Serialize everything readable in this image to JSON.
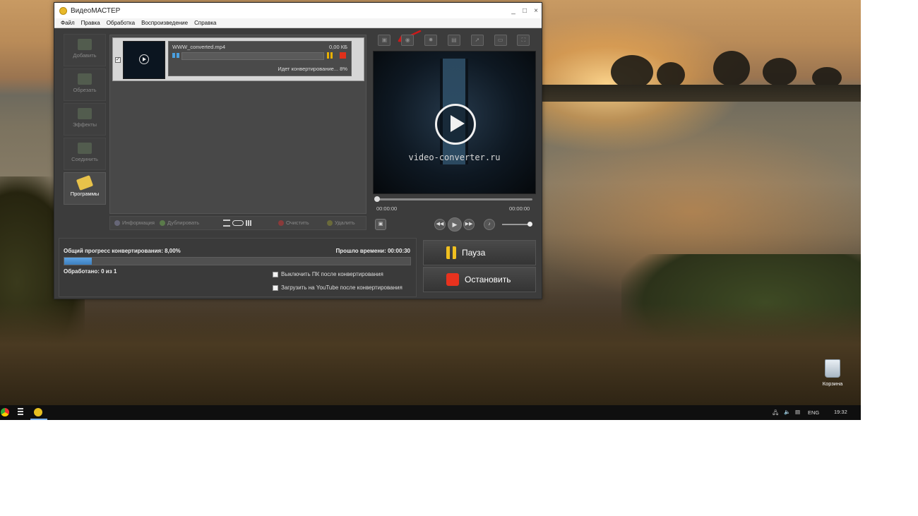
{
  "window": {
    "title": "ВидеоМАСТЕР",
    "controls": [
      "_",
      "□",
      "×"
    ]
  },
  "menu": [
    "Файл",
    "Правка",
    "Обработка",
    "Воспроизведение",
    "Справка"
  ],
  "sidebar": [
    {
      "label": "Добавить",
      "icon": "add-video-icon"
    },
    {
      "label": "Обрезать",
      "icon": "trim-icon"
    },
    {
      "label": "Эффекты",
      "icon": "effects-icon"
    },
    {
      "label": "Соединить",
      "icon": "join-icon"
    },
    {
      "label": "Программы",
      "icon": "programs-icon"
    }
  ],
  "file_item": {
    "name": "WWW_converted.mp4",
    "size": "0,00 КБ",
    "status": "Идет конвертирование... 8%",
    "progress": 0.0
  },
  "file_tools": {
    "info": "Информация",
    "duplicate": "Дублировать",
    "clear": "Очистить",
    "delete": "Удалить"
  },
  "preview": {
    "watermark": "video-converter.ru",
    "time_current": "00:00:00",
    "time_total": "00:00:00",
    "tools": [
      "crop-icon",
      "snapshot-icon",
      "brightness-icon",
      "film-icon",
      "speed-icon",
      "gif-icon",
      "fullscreen-icon"
    ]
  },
  "progress": {
    "total_label": "Общий прогресс конвертирования: 8,00%",
    "elapsed_label": "Прошло времени: 00:00:30",
    "processed_label": "Обработано: 0 из 1",
    "total_fraction": 0.08,
    "shutdown_option": "Выключить ПК после конвертирования",
    "youtube_option": "Загрузить на YouTube после конвертирования"
  },
  "actions": {
    "pause": "Пауза",
    "stop": "Остановить"
  },
  "desktop": {
    "trash_label": "Корзина",
    "lang": "ENG",
    "clock": "19:32"
  }
}
